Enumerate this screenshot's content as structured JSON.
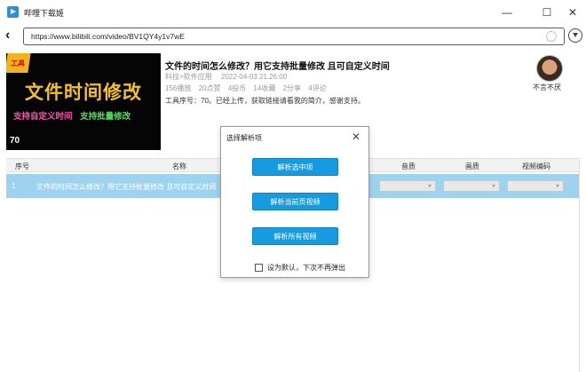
{
  "app": {
    "title": "哔哩下载姬"
  },
  "window": {
    "min": "—",
    "max": "☐",
    "close": "✕"
  },
  "address": {
    "back": "‹",
    "url": "https://www.bilibili.com/video/BV1QY4y1v7wE"
  },
  "thumbnail": {
    "badge": "工具",
    "title": "文件时间修改",
    "sub_a": "支持自定义时间",
    "sub_b": "支持批量修改",
    "number": "70"
  },
  "video": {
    "title": "文件的时间怎么修改？用它支持批量修改 且可自定义时间",
    "category": "科技>软件应用",
    "date": "2022-04-03 21:26:00",
    "stats": [
      "156播放",
      "20点赞",
      "4投币",
      "14收藏",
      "2分享",
      "4评论"
    ],
    "description": "工具序号：70。已经上传，获取链接请看我的简介，感谢支持。"
  },
  "uploader": {
    "name": "不言不厌"
  },
  "table": {
    "headers": {
      "index": "序号",
      "name": "名称",
      "audio": "音质",
      "quality": "画质",
      "codec": "视频编码"
    },
    "rows": [
      {
        "index": "1",
        "name": "文件的时间怎么修改？用它支持批量修改 且可自定义时间"
      }
    ]
  },
  "dialog": {
    "title": "选择解析项",
    "close": "✕",
    "btn_selected": "解析选中项",
    "btn_current": "解析当前页视频",
    "btn_all": "解析所有视频",
    "checkbox_label": "设为默认，下次不再弹出"
  },
  "colors": {
    "accent": "#179be0",
    "row_selected": "#9ed3f0"
  }
}
